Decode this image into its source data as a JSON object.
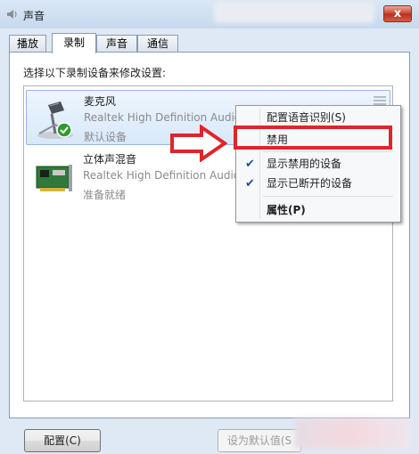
{
  "window": {
    "title": "声音",
    "close_label": "x"
  },
  "tabs": [
    {
      "label": "播放",
      "active": false
    },
    {
      "label": "录制",
      "active": true
    },
    {
      "label": "声音",
      "active": false
    },
    {
      "label": "通信",
      "active": false
    }
  ],
  "instruction": "选择以下录制设备来修改设置:",
  "devices": [
    {
      "name": "麦克风",
      "description": "Realtek High Definition Audio",
      "status": "默认设备",
      "icon": "microphone-icon",
      "selected": true,
      "default_check": true
    },
    {
      "name": "立体声混音",
      "description": "Realtek High Definition Audio",
      "status": "准备就绪",
      "icon": "sound-card-icon",
      "selected": false
    }
  ],
  "context_menu": {
    "items": [
      {
        "label": "配置语音识别(S)",
        "checked": false,
        "bold": false
      },
      {
        "label": "禁用",
        "checked": false,
        "bold": false,
        "highlighted_by_annotation": true
      },
      {
        "label": "显示禁用的设备",
        "checked": true,
        "bold": false
      },
      {
        "label": "显示已断开的设备",
        "checked": true,
        "bold": false
      },
      {
        "label": "属性(P)",
        "checked": false,
        "bold": true
      }
    ]
  },
  "buttons": {
    "configure": "配置(C)",
    "set_default": "设为默认值(S"
  },
  "annotation": {
    "arrow_color": "#e0242b",
    "box_color": "#e0242b"
  },
  "colors": {
    "selected_row": "#d8e8fa",
    "check": "#1f4f9c"
  }
}
